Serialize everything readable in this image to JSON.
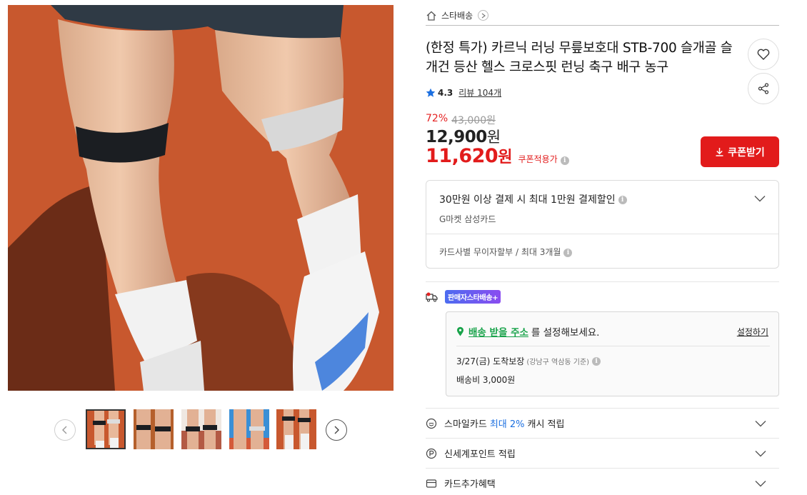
{
  "gallery": {
    "main_alt": "knee strap product photo",
    "prev_icon": "chevron-left-icon",
    "next_icon": "chevron-right-icon",
    "thumbnail_count": 5,
    "active_thumbnail": 1
  },
  "store": {
    "icon": "home-icon",
    "name": "스타배송"
  },
  "product": {
    "title": "(한정 특가) 카르닉 러닝 무릎보호대 STB-700 슬개골 슬개건 등산 헬스 크로스핏 런닝 축구 배구 농구",
    "rating": "4.3",
    "review_label": "리뷰 104개",
    "discount_rate": "72%",
    "original_price": "43,000원",
    "sale_price": "12,900",
    "sale_unit": "원",
    "coupon_price": "11,620",
    "coupon_unit": "원",
    "coupon_applied_label": "쿠폰적용가"
  },
  "actions": {
    "wishlist_icon": "heart-icon",
    "share_icon": "share-icon",
    "coupon_button_label": "쿠폰받기"
  },
  "card_promo": {
    "title": "30만원 이상 결제 시 최대 1만원 결제할인",
    "subtitle": "G마켓 삼성카드",
    "installment": "카드사별 무이자할부 / 최대 3개월"
  },
  "shipping": {
    "badge": "판매자스타배송+",
    "address_link": "배송 받을 주소",
    "address_suffix": "를 설정해보세요.",
    "set_link": "설정하기",
    "delivery_date": "3/27(금) 도착보장",
    "delivery_note": "(강남구 역삼동 기준)",
    "fee": "배송비 3,000원"
  },
  "benefits": [
    {
      "icon": "smile-card-icon",
      "prefix": "스마일카드",
      "highlight": "최대 2%",
      "suffix": "캐시 적립"
    },
    {
      "icon": "point-icon",
      "prefix": "신세계포인트 적립",
      "highlight": "",
      "suffix": ""
    },
    {
      "icon": "card-icon",
      "prefix": "카드추가혜택",
      "highlight": "",
      "suffix": ""
    }
  ],
  "colors": {
    "accent_red": "#e21b1b",
    "discount_red": "#e52222",
    "link_green": "#18a34a",
    "highlight_blue": "#1b6fe0",
    "track_orange": "#c8582e"
  }
}
